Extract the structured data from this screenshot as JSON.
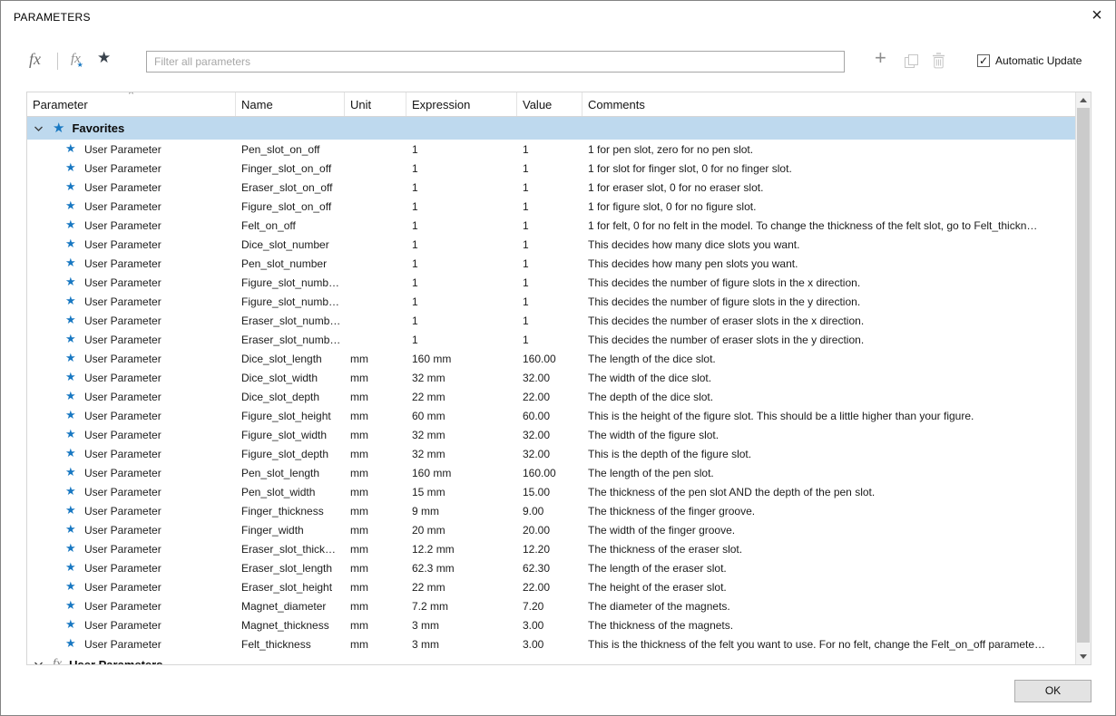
{
  "window": {
    "title": "PARAMETERS",
    "close_glyph": "×"
  },
  "toolbar": {
    "fx_glyph": "fx",
    "fx_user_glyph": "fx",
    "fx_user_accent_glyph": "★",
    "star_glyph": "★",
    "filter": {
      "placeholder": "Filter all parameters",
      "value": ""
    },
    "add_glyph": "+",
    "auto_update": {
      "label": "Automatic Update",
      "checked": true,
      "check_glyph": "✓"
    }
  },
  "table": {
    "sort_indicator": "^",
    "columns": [
      {
        "label": "Parameter"
      },
      {
        "label": "Name"
      },
      {
        "label": "Unit"
      },
      {
        "label": "Expression"
      },
      {
        "label": "Value"
      },
      {
        "label": "Comments"
      }
    ],
    "favorites_group": {
      "label": "Favorites",
      "star_glyph": "★"
    },
    "user_parameters_group": {
      "label": "User Parameters",
      "fx_glyph": "fx"
    },
    "row_star_glyph": "★",
    "rows": [
      {
        "type": "User Parameter",
        "name": "Pen_slot_on_off",
        "unit": "",
        "expression": "1",
        "value": "1",
        "comments": "1 for pen slot, zero for no pen slot."
      },
      {
        "type": "User Parameter",
        "name": "Finger_slot_on_off",
        "unit": "",
        "expression": "1",
        "value": "1",
        "comments": "1 for slot for finger slot, 0 for no finger slot."
      },
      {
        "type": "User Parameter",
        "name": "Eraser_slot_on_off",
        "unit": "",
        "expression": "1",
        "value": "1",
        "comments": "1 for eraser slot, 0 for no eraser slot."
      },
      {
        "type": "User Parameter",
        "name": "Figure_slot_on_off",
        "unit": "",
        "expression": "1",
        "value": "1",
        "comments": "1 for figure slot, 0 for no figure slot."
      },
      {
        "type": "User Parameter",
        "name": "Felt_on_off",
        "unit": "",
        "expression": "1",
        "value": "1",
        "comments": "1 for felt, 0 for no felt in the model. To change the thickness of the felt slot, go to Felt_thickn…"
      },
      {
        "type": "User Parameter",
        "name": "Dice_slot_number",
        "unit": "",
        "expression": "1",
        "value": "1",
        "comments": "This decides how many dice slots you want."
      },
      {
        "type": "User Parameter",
        "name": "Pen_slot_number",
        "unit": "",
        "expression": "1",
        "value": "1",
        "comments": "This decides how many pen slots you want."
      },
      {
        "type": "User Parameter",
        "name": "Figure_slot_numb…",
        "unit": "",
        "expression": "1",
        "value": "1",
        "comments": "This decides the number of figure slots in the x direction."
      },
      {
        "type": "User Parameter",
        "name": "Figure_slot_numb…",
        "unit": "",
        "expression": "1",
        "value": "1",
        "comments": "This decides the number of figure slots in the y direction."
      },
      {
        "type": "User Parameter",
        "name": "Eraser_slot_numb…",
        "unit": "",
        "expression": "1",
        "value": "1",
        "comments": "This decides the number of eraser slots in the x direction."
      },
      {
        "type": "User Parameter",
        "name": "Eraser_slot_numb…",
        "unit": "",
        "expression": "1",
        "value": "1",
        "comments": "This decides the number of eraser slots in the y direction."
      },
      {
        "type": "User Parameter",
        "name": "Dice_slot_length",
        "unit": "mm",
        "expression": "160 mm",
        "value": "160.00",
        "comments": "The length of the dice slot."
      },
      {
        "type": "User Parameter",
        "name": "Dice_slot_width",
        "unit": "mm",
        "expression": "32 mm",
        "value": "32.00",
        "comments": "The width of the dice slot."
      },
      {
        "type": "User Parameter",
        "name": "Dice_slot_depth",
        "unit": "mm",
        "expression": "22 mm",
        "value": "22.00",
        "comments": "The depth of the dice slot."
      },
      {
        "type": "User Parameter",
        "name": "Figure_slot_height",
        "unit": "mm",
        "expression": "60 mm",
        "value": "60.00",
        "comments": "This is the height of the figure slot. This should be a little higher than your figure."
      },
      {
        "type": "User Parameter",
        "name": "Figure_slot_width",
        "unit": "mm",
        "expression": "32 mm",
        "value": "32.00",
        "comments": "The width of the figure slot."
      },
      {
        "type": "User Parameter",
        "name": "Figure_slot_depth",
        "unit": "mm",
        "expression": "32 mm",
        "value": "32.00",
        "comments": "This is the depth of the figure slot."
      },
      {
        "type": "User Parameter",
        "name": "Pen_slot_length",
        "unit": "mm",
        "expression": "160 mm",
        "value": "160.00",
        "comments": "The length of the pen slot."
      },
      {
        "type": "User Parameter",
        "name": "Pen_slot_width",
        "unit": "mm",
        "expression": "15 mm",
        "value": "15.00",
        "comments": "The thickness of the pen slot AND the depth of the pen slot."
      },
      {
        "type": "User Parameter",
        "name": "Finger_thickness",
        "unit": "mm",
        "expression": "9 mm",
        "value": "9.00",
        "comments": "The thickness of the finger groove."
      },
      {
        "type": "User Parameter",
        "name": "Finger_width",
        "unit": "mm",
        "expression": "20 mm",
        "value": "20.00",
        "comments": "The width of the finger groove."
      },
      {
        "type": "User Parameter",
        "name": "Eraser_slot_thick…",
        "unit": "mm",
        "expression": "12.2 mm",
        "value": "12.20",
        "comments": "The thickness of the eraser slot."
      },
      {
        "type": "User Parameter",
        "name": "Eraser_slot_length",
        "unit": "mm",
        "expression": "62.3 mm",
        "value": "62.30",
        "comments": "The length of the eraser slot."
      },
      {
        "type": "User Parameter",
        "name": "Eraser_slot_height",
        "unit": "mm",
        "expression": "22 mm",
        "value": "22.00",
        "comments": "The height of the eraser slot."
      },
      {
        "type": "User Parameter",
        "name": "Magnet_diameter",
        "unit": "mm",
        "expression": "7.2 mm",
        "value": "7.20",
        "comments": "The diameter of the magnets."
      },
      {
        "type": "User Parameter",
        "name": "Magnet_thickness",
        "unit": "mm",
        "expression": "3 mm",
        "value": "3.00",
        "comments": "The thickness of the magnets."
      },
      {
        "type": "User Parameter",
        "name": "Felt_thickness",
        "unit": "mm",
        "expression": "3 mm",
        "value": "3.00",
        "comments": "This is the thickness of the felt you want to use. For no felt, change the Felt_on_off paramete…"
      }
    ]
  },
  "footer": {
    "ok_label": "OK"
  }
}
